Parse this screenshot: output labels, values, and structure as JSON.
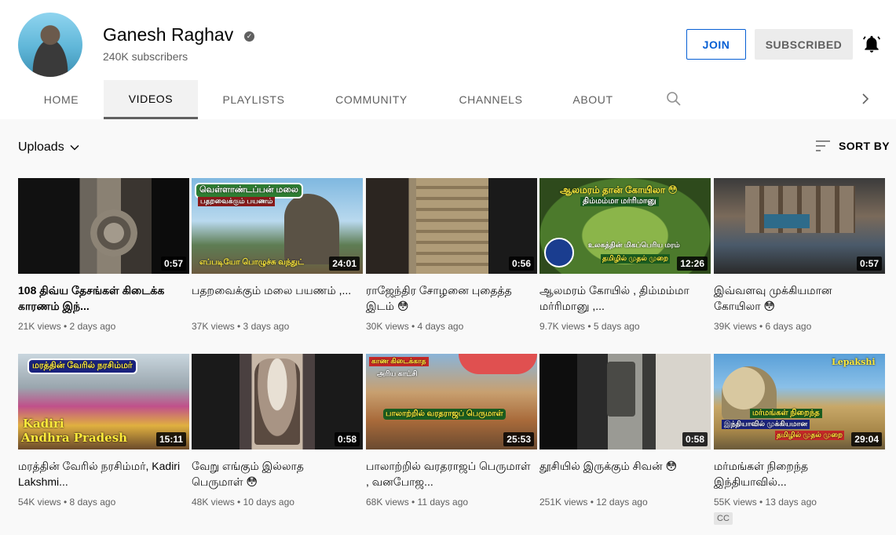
{
  "channel": {
    "name": "Ganesh Raghav",
    "subscribers": "240K subscribers",
    "join_label": "JOIN",
    "subscribed_label": "SUBSCRIBED"
  },
  "tabs": [
    "HOME",
    "VIDEOS",
    "PLAYLISTS",
    "COMMUNITY",
    "CHANNELS",
    "ABOUT"
  ],
  "active_tab": "VIDEOS",
  "section": {
    "uploads_label": "Uploads",
    "sort_label": "SORT BY"
  },
  "videos": [
    {
      "title": "108 திவ்ய தேசங்கள் கிடைக்க காரணம் இந்...",
      "meta": "21K views • 2 days ago",
      "duration": "0:57"
    },
    {
      "title": "பதறவைக்கும் மலை பயணம் ,...",
      "meta": "37K views • 3 days ago",
      "duration": "24:01",
      "overlay_top": "வெள்ளாண்டப்பன் மலை",
      "overlay_sub": "பதறவைக்கும் பயணம்",
      "overlay_bottom": "எப்படியோ பொழுச்சு வந்துட்"
    },
    {
      "title": "ராஜேந்திர சோழனை புதைத்த இடம் 😳",
      "meta": "30K views • 4 days ago",
      "duration": "0:56"
    },
    {
      "title": "ஆலமரம் கோயில் , திம்மம்மா மர்ரிமானு ,...",
      "meta": "9.7K views • 5 days ago",
      "duration": "12:26",
      "overlay_top": "ஆலமரம் தான் கோயிலா 😳",
      "overlay_sub": "திம்மம்மா மர்ரிமானு",
      "overlay_bottom": "உலகத்தின் மிகப்பெரிய மரம்",
      "overlay_bottom2": "தமிழில் முதல் முறை"
    },
    {
      "title": "இவ்வளவு முக்கியமான கோயிலா 😳",
      "meta": "39K views • 6 days ago",
      "duration": "0:57"
    },
    {
      "title": "மரத்தின் வேரில் நரசிம்மர், Kadiri Lakshmi...",
      "meta": "54K views • 8 days ago",
      "duration": "15:11",
      "overlay_top": "மரத்தின் வேரில் நரசிம்மர்",
      "overlay_bottom": "Kadiri",
      "overlay_bottom2": "Andhra Pradesh"
    },
    {
      "title": "வேறு எங்கும் இல்லாத பெருமாள் 😳",
      "meta": "48K views • 10 days ago",
      "duration": "0:58"
    },
    {
      "title": "பாலாற்றில் வரதராஜப் பெருமாள் , வனபோஜ...",
      "meta": "68K views • 11 days ago",
      "duration": "25:53",
      "overlay_top": "காண கிடைக்காத",
      "overlay_sub": "அரிய காட்சி",
      "overlay_bottom": "பாலாற்றில் வரதராஜப் பெருமாள்"
    },
    {
      "title": "தூசியில் இருக்கும் சிவன் 😳",
      "meta": "251K views • 12 days ago",
      "duration": "0:58"
    },
    {
      "title": "மர்மங்கள் நிறைந்த இந்தியாவில்...",
      "meta": "55K views • 13 days ago",
      "duration": "29:04",
      "cc": "CC",
      "overlay_top": "Lepakshi",
      "overlay_bottom": "மர்மங்கள் நிறைந்த",
      "overlay_bottom2": "இந்தியாவில் முக்கியமான",
      "overlay_bottom3": "தமிழில் முதல் முறை"
    }
  ]
}
